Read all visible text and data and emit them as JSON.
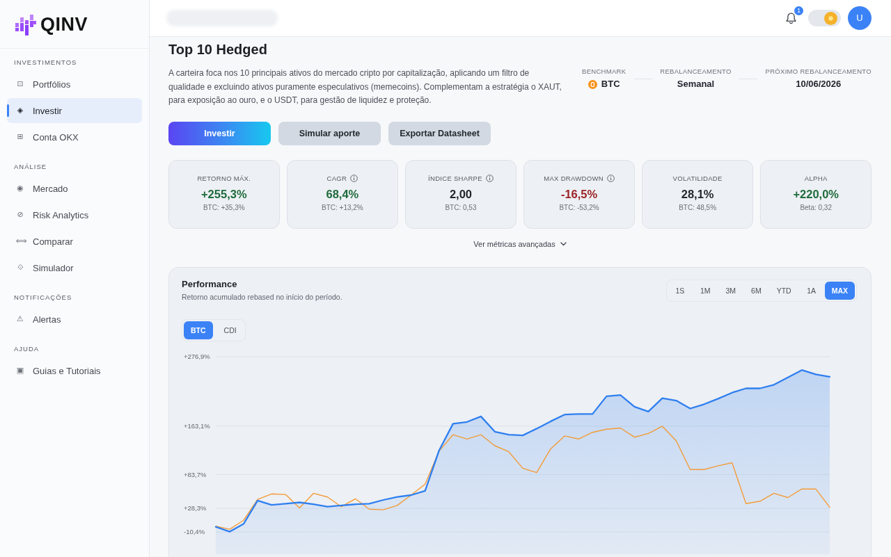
{
  "sidebar": {
    "logo": {
      "text": "QINV"
    },
    "sections": [
      {
        "title": "INVESTIMENTOS",
        "items": [
          {
            "icon": "⊡",
            "label": "Portfólios",
            "selected": false
          },
          {
            "icon": "◈",
            "label": "Investir",
            "selected": true
          },
          {
            "icon": "⊞",
            "label": "Conta OKX",
            "selected": false
          }
        ]
      },
      {
        "title": "ANÁLISE",
        "items": [
          {
            "icon": "◉",
            "label": "Mercado",
            "selected": false
          },
          {
            "icon": "⊘",
            "label": "Risk Analytics",
            "selected": false
          },
          {
            "icon": "⟺",
            "label": "Comparar",
            "selected": false
          },
          {
            "icon": "⟐",
            "label": "Simulador",
            "selected": false
          }
        ]
      },
      {
        "title": "NOTIFICAÇÕES",
        "items": [
          {
            "icon": "⚠",
            "label": "Alertas",
            "selected": false
          }
        ]
      },
      {
        "title": "AJUDA",
        "items": [
          {
            "icon": "▣",
            "label": "Guias e Tutoriais",
            "selected": false
          }
        ]
      }
    ]
  },
  "header": {
    "notifications": {
      "count": "1"
    },
    "theme_toggle": {
      "on": true
    },
    "avatar": {
      "initial": "U"
    }
  },
  "portfolio": {
    "title": "Top 10 Hedged",
    "description": "A carteira foca nos 10 principais ativos do mercado cripto por capitalização, aplicando um filtro de qualidade e excluindo ativos puramente especulativos (memecoins). Complementam a estratégia o XAUT, para exposição ao ouro, e o USDT, para gestão de liquidez e proteção.",
    "meta": [
      {
        "label": "BENCHMARK",
        "value": "BTC",
        "kind": "coin"
      },
      {
        "label": "REBALANCEAMENTO",
        "value": "Semanal",
        "kind": "text"
      },
      {
        "label": "PRÓXIMO REBALANCEAMENTO",
        "value": "10/06/2026",
        "kind": "text"
      }
    ],
    "actions": [
      {
        "label": "Investir",
        "kind": "primary"
      },
      {
        "label": "Simular aporte",
        "kind": "secondary"
      },
      {
        "label": "Exportar Datasheet",
        "kind": "secondary"
      }
    ]
  },
  "metrics": [
    {
      "label": "RETORNO MÁX.",
      "info": false,
      "value": "+255,3%",
      "color": "#1e6b3c",
      "sub": "BTC: +35,3%"
    },
    {
      "label": "CAGR",
      "info": true,
      "value": "68,4%",
      "color": "#1e6b3c",
      "sub": "BTC: +13,2%"
    },
    {
      "label": "ÍNDICE SHARPE",
      "info": true,
      "value": "2,00",
      "color": "#23272e",
      "sub": "BTC: 0,53"
    },
    {
      "label": "MAX DRAWDOWN",
      "info": true,
      "value": "-16,5%",
      "color": "#9b2226",
      "sub": "BTC: -53,2%"
    },
    {
      "label": "VOLATILIDADE",
      "info": false,
      "value": "28,1%",
      "color": "#23272e",
      "sub": "BTC: 48,5%"
    },
    {
      "label": "ALPHA",
      "info": false,
      "value": "+220,0%",
      "color": "#1e6b3c",
      "sub": "Beta: 0,32"
    }
  ],
  "advanced_metrics": {
    "label": "Ver métricas avançadas",
    "expanded": false
  },
  "performance": {
    "title": "Performance",
    "subtitle": "Retorno acumulado rebased no início do período.",
    "ranges": [
      {
        "label": "1S",
        "selected": false
      },
      {
        "label": "1M",
        "selected": false
      },
      {
        "label": "3M",
        "selected": false
      },
      {
        "label": "6M",
        "selected": false
      },
      {
        "label": "YTD",
        "selected": false
      },
      {
        "label": "1A",
        "selected": false
      },
      {
        "label": "MAX",
        "selected": true
      }
    ],
    "benchmarks": [
      {
        "label": "BTC",
        "selected": true
      },
      {
        "label": "CDI",
        "selected": false
      }
    ],
    "chart_data": {
      "type": "line",
      "grid": true,
      "ylim": [
        -10.4,
        276.9
      ],
      "yticks": [
        {
          "value": 276.9,
          "label": "+276,9%"
        },
        {
          "value": 163.1,
          "label": "+163,1%"
        },
        {
          "value": 83.7,
          "label": "+83,7%"
        },
        {
          "value": 28.3,
          "label": "+28,3%"
        },
        {
          "value": -10.4,
          "label": "-10,4%"
        }
      ],
      "series": [
        {
          "type": "area",
          "color": "#2f7ff0",
          "values": [
            -2,
            -10,
            3,
            41,
            34,
            36,
            38,
            35,
            31,
            33,
            35,
            36,
            42,
            47,
            50,
            57,
            123,
            167,
            170,
            179,
            154,
            149,
            148,
            159,
            171,
            182,
            183,
            183,
            212,
            214,
            195,
            187,
            209,
            205,
            192,
            199,
            208,
            218,
            225,
            225,
            231,
            243,
            255,
            248,
            244
          ]
        },
        {
          "type": "line",
          "color": "#f39c38",
          "values": [
            -1,
            -6,
            9,
            43,
            52,
            51,
            29,
            53,
            47,
            31,
            44,
            27,
            26,
            33,
            50,
            68,
            122,
            149,
            142,
            149,
            131,
            121,
            94,
            87,
            126,
            147,
            142,
            153,
            158,
            160,
            145,
            151,
            163,
            139,
            92,
            92,
            98,
            103,
            36,
            40,
            53,
            46,
            60,
            60,
            30
          ]
        }
      ]
    }
  }
}
